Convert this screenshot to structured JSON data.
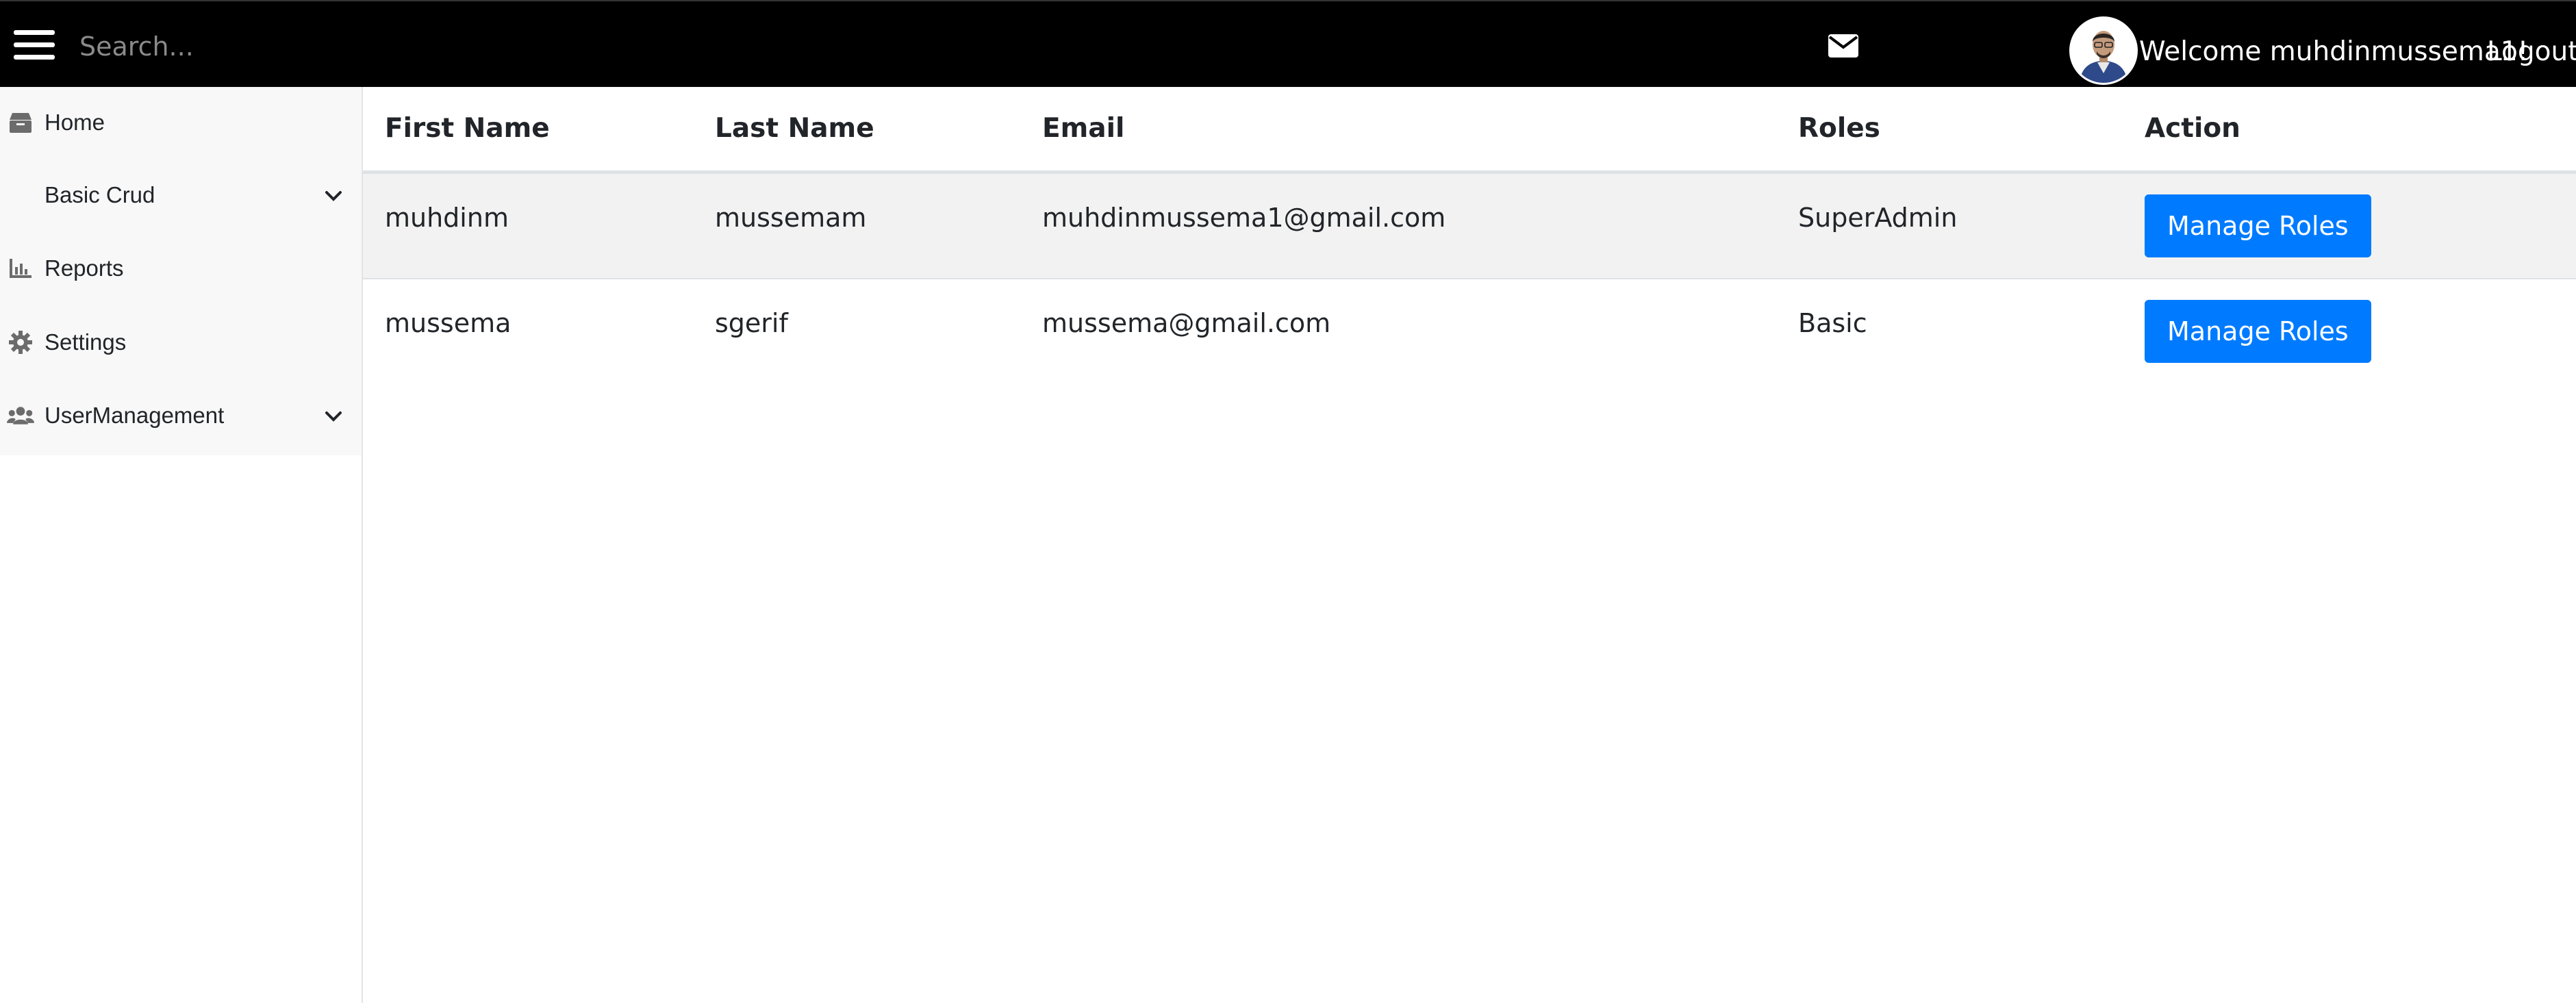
{
  "header": {
    "search_placeholder": "Search...",
    "welcome_text": "Welcome muhdinmussema1!",
    "logout_label": "Logout",
    "colors": {
      "bar_background": "#000000",
      "text": "#ffffff",
      "placeholder": "#8a8a8a"
    }
  },
  "sidebar": {
    "items": [
      {
        "label": "Home",
        "icon": "box-icon"
      },
      {
        "label": "Basic Crud",
        "icon": "",
        "expandable": true
      },
      {
        "label": "Reports",
        "icon": "bar-chart-icon"
      },
      {
        "label": "Settings",
        "icon": "gear-icon"
      },
      {
        "label": "UserManagement",
        "icon": "users-icon",
        "expandable": true
      }
    ]
  },
  "table": {
    "columns": [
      "First Name",
      "Last Name",
      "Email",
      "Roles",
      "Action"
    ],
    "rows": [
      {
        "first_name": "muhdinm",
        "last_name": "mussemam",
        "email": "muhdinmussema1@gmail.com",
        "roles": "SuperAdmin",
        "action": "Manage Roles"
      },
      {
        "first_name": "mussema",
        "last_name": "sgerif",
        "email": "mussema@gmail.com",
        "roles": "Basic",
        "action": "Manage Roles"
      }
    ]
  },
  "colors": {
    "primary_button": "#007bff",
    "striped_row": "#f2f2f2",
    "sidebar_background": "#f8f8f8"
  }
}
